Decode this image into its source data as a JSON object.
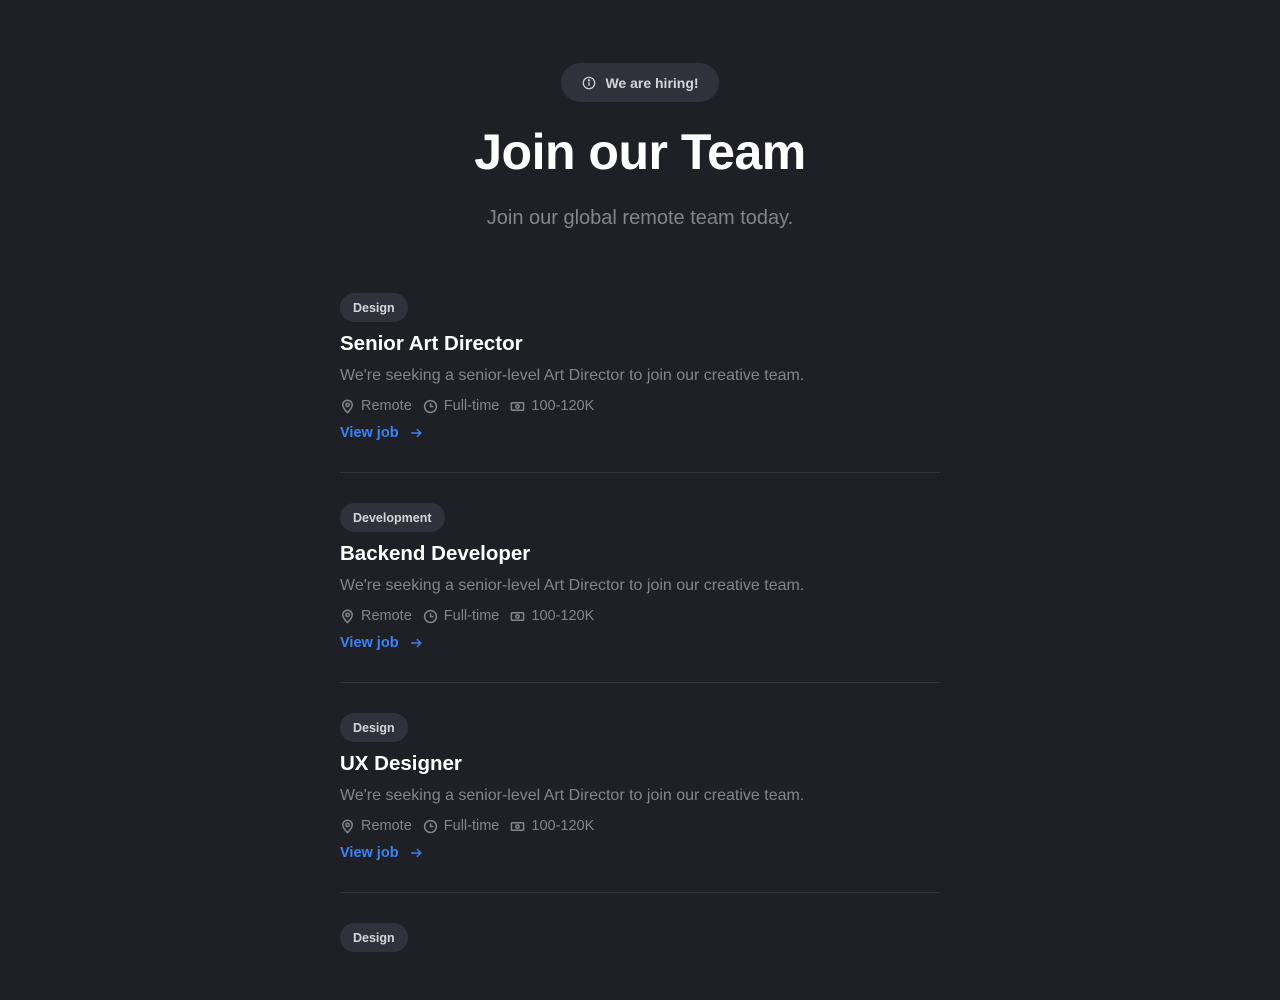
{
  "hero": {
    "badge_icon": "info-icon",
    "badge_label": "We are hiring!",
    "title": "Join our Team",
    "subtitle": "Join our global remote team today."
  },
  "colors": {
    "background": "#1f2025",
    "pill": "#30323b",
    "muted_text": "#80858f",
    "link": "#3b82f6"
  },
  "jobs": [
    {
      "category": "Design",
      "title": "Senior Art Director",
      "description": "We're seeking a senior-level Art Director to join our creative team.",
      "location": "Remote",
      "type": "Full-time",
      "salary": "100-120K",
      "link_label": "View job"
    },
    {
      "category": "Development",
      "title": "Backend Developer",
      "description": "We're seeking a senior-level Art Director to join our creative team.",
      "location": "Remote",
      "type": "Full-time",
      "salary": "100-120K",
      "link_label": "View job"
    },
    {
      "category": "Design",
      "title": "UX Designer",
      "description": "We're seeking a senior-level Art Director to join our creative team.",
      "location": "Remote",
      "type": "Full-time",
      "salary": "100-120K",
      "link_label": "View job"
    },
    {
      "category": "Design"
    }
  ]
}
